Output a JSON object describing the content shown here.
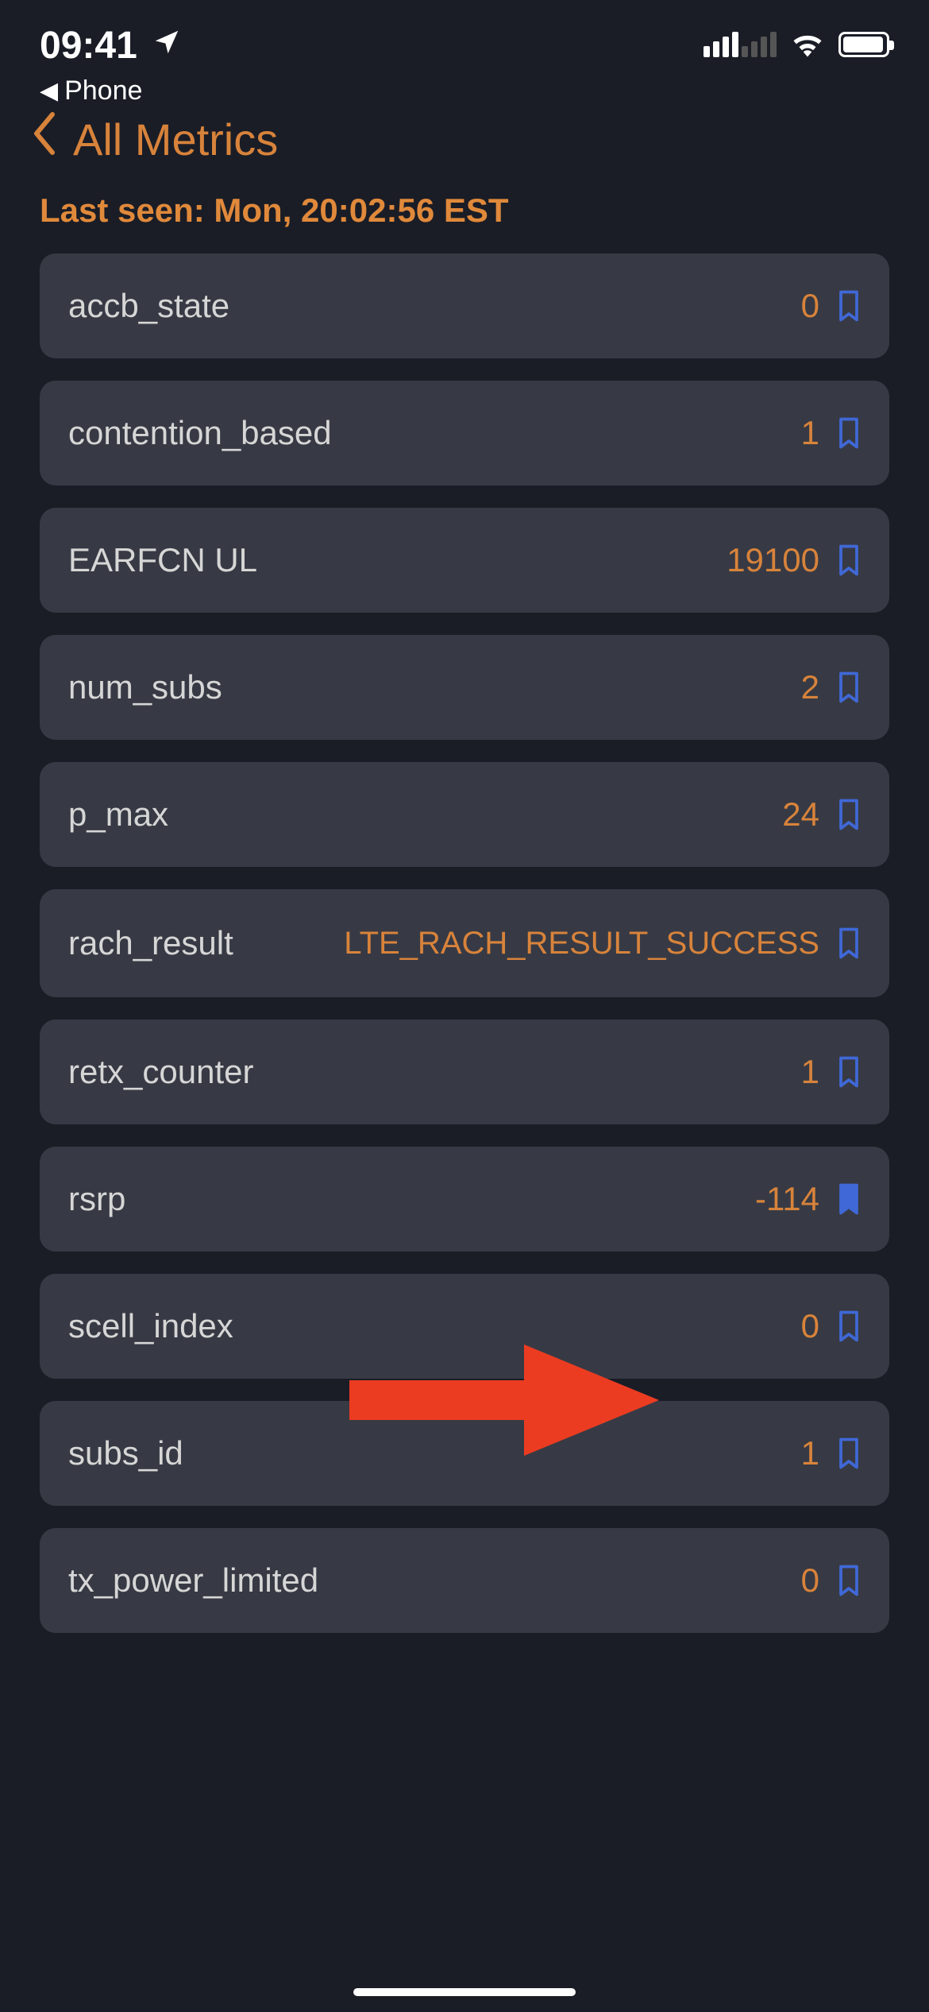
{
  "statusBar": {
    "time": "09:41",
    "backApp": "Phone"
  },
  "header": {
    "title": "All Metrics",
    "subtitle": "Last seen: Mon, 20:02:56 EST"
  },
  "metrics": [
    {
      "name": "accb_state",
      "value": "0",
      "bookmarked": false
    },
    {
      "name": "contention_based",
      "value": "1",
      "bookmarked": false
    },
    {
      "name": "EARFCN UL",
      "value": "19100",
      "bookmarked": false
    },
    {
      "name": "num_subs",
      "value": "2",
      "bookmarked": false
    },
    {
      "name": "p_max",
      "value": "24",
      "bookmarked": false
    },
    {
      "name": "rach_result",
      "value": "LTE_RACH_RESULT_SUCCESS",
      "bookmarked": false,
      "long": true
    },
    {
      "name": "retx_counter",
      "value": "1",
      "bookmarked": false
    },
    {
      "name": "rsrp",
      "value": "-114",
      "bookmarked": true
    },
    {
      "name": "scell_index",
      "value": "0",
      "bookmarked": false
    },
    {
      "name": "subs_id",
      "value": "1",
      "bookmarked": false
    },
    {
      "name": "tx_power_limited",
      "value": "0",
      "bookmarked": false
    }
  ],
  "colors": {
    "accent": "#d8833b",
    "bookmark": "#4068d6",
    "cardBg": "#373a44",
    "bg": "#1a1d26",
    "arrow": "#eb3c22"
  }
}
